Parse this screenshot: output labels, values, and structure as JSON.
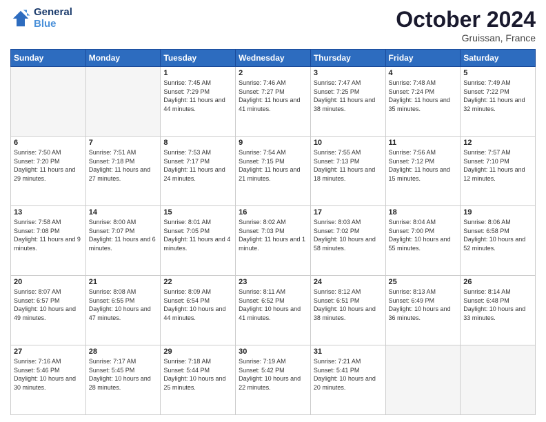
{
  "header": {
    "logo_line1": "General",
    "logo_line2": "Blue",
    "month": "October 2024",
    "location": "Gruissan, France"
  },
  "weekdays": [
    "Sunday",
    "Monday",
    "Tuesday",
    "Wednesday",
    "Thursday",
    "Friday",
    "Saturday"
  ],
  "weeks": [
    [
      {
        "day": "",
        "sunrise": "",
        "sunset": "",
        "daylight": "",
        "empty": true
      },
      {
        "day": "",
        "sunrise": "",
        "sunset": "",
        "daylight": "",
        "empty": true
      },
      {
        "day": "1",
        "sunrise": "Sunrise: 7:45 AM",
        "sunset": "Sunset: 7:29 PM",
        "daylight": "Daylight: 11 hours and 44 minutes."
      },
      {
        "day": "2",
        "sunrise": "Sunrise: 7:46 AM",
        "sunset": "Sunset: 7:27 PM",
        "daylight": "Daylight: 11 hours and 41 minutes."
      },
      {
        "day": "3",
        "sunrise": "Sunrise: 7:47 AM",
        "sunset": "Sunset: 7:25 PM",
        "daylight": "Daylight: 11 hours and 38 minutes."
      },
      {
        "day": "4",
        "sunrise": "Sunrise: 7:48 AM",
        "sunset": "Sunset: 7:24 PM",
        "daylight": "Daylight: 11 hours and 35 minutes."
      },
      {
        "day": "5",
        "sunrise": "Sunrise: 7:49 AM",
        "sunset": "Sunset: 7:22 PM",
        "daylight": "Daylight: 11 hours and 32 minutes."
      }
    ],
    [
      {
        "day": "6",
        "sunrise": "Sunrise: 7:50 AM",
        "sunset": "Sunset: 7:20 PM",
        "daylight": "Daylight: 11 hours and 29 minutes."
      },
      {
        "day": "7",
        "sunrise": "Sunrise: 7:51 AM",
        "sunset": "Sunset: 7:18 PM",
        "daylight": "Daylight: 11 hours and 27 minutes."
      },
      {
        "day": "8",
        "sunrise": "Sunrise: 7:53 AM",
        "sunset": "Sunset: 7:17 PM",
        "daylight": "Daylight: 11 hours and 24 minutes."
      },
      {
        "day": "9",
        "sunrise": "Sunrise: 7:54 AM",
        "sunset": "Sunset: 7:15 PM",
        "daylight": "Daylight: 11 hours and 21 minutes."
      },
      {
        "day": "10",
        "sunrise": "Sunrise: 7:55 AM",
        "sunset": "Sunset: 7:13 PM",
        "daylight": "Daylight: 11 hours and 18 minutes."
      },
      {
        "day": "11",
        "sunrise": "Sunrise: 7:56 AM",
        "sunset": "Sunset: 7:12 PM",
        "daylight": "Daylight: 11 hours and 15 minutes."
      },
      {
        "day": "12",
        "sunrise": "Sunrise: 7:57 AM",
        "sunset": "Sunset: 7:10 PM",
        "daylight": "Daylight: 11 hours and 12 minutes."
      }
    ],
    [
      {
        "day": "13",
        "sunrise": "Sunrise: 7:58 AM",
        "sunset": "Sunset: 7:08 PM",
        "daylight": "Daylight: 11 hours and 9 minutes."
      },
      {
        "day": "14",
        "sunrise": "Sunrise: 8:00 AM",
        "sunset": "Sunset: 7:07 PM",
        "daylight": "Daylight: 11 hours and 6 minutes."
      },
      {
        "day": "15",
        "sunrise": "Sunrise: 8:01 AM",
        "sunset": "Sunset: 7:05 PM",
        "daylight": "Daylight: 11 hours and 4 minutes."
      },
      {
        "day": "16",
        "sunrise": "Sunrise: 8:02 AM",
        "sunset": "Sunset: 7:03 PM",
        "daylight": "Daylight: 11 hours and 1 minute."
      },
      {
        "day": "17",
        "sunrise": "Sunrise: 8:03 AM",
        "sunset": "Sunset: 7:02 PM",
        "daylight": "Daylight: 10 hours and 58 minutes."
      },
      {
        "day": "18",
        "sunrise": "Sunrise: 8:04 AM",
        "sunset": "Sunset: 7:00 PM",
        "daylight": "Daylight: 10 hours and 55 minutes."
      },
      {
        "day": "19",
        "sunrise": "Sunrise: 8:06 AM",
        "sunset": "Sunset: 6:58 PM",
        "daylight": "Daylight: 10 hours and 52 minutes."
      }
    ],
    [
      {
        "day": "20",
        "sunrise": "Sunrise: 8:07 AM",
        "sunset": "Sunset: 6:57 PM",
        "daylight": "Daylight: 10 hours and 49 minutes."
      },
      {
        "day": "21",
        "sunrise": "Sunrise: 8:08 AM",
        "sunset": "Sunset: 6:55 PM",
        "daylight": "Daylight: 10 hours and 47 minutes."
      },
      {
        "day": "22",
        "sunrise": "Sunrise: 8:09 AM",
        "sunset": "Sunset: 6:54 PM",
        "daylight": "Daylight: 10 hours and 44 minutes."
      },
      {
        "day": "23",
        "sunrise": "Sunrise: 8:11 AM",
        "sunset": "Sunset: 6:52 PM",
        "daylight": "Daylight: 10 hours and 41 minutes."
      },
      {
        "day": "24",
        "sunrise": "Sunrise: 8:12 AM",
        "sunset": "Sunset: 6:51 PM",
        "daylight": "Daylight: 10 hours and 38 minutes."
      },
      {
        "day": "25",
        "sunrise": "Sunrise: 8:13 AM",
        "sunset": "Sunset: 6:49 PM",
        "daylight": "Daylight: 10 hours and 36 minutes."
      },
      {
        "day": "26",
        "sunrise": "Sunrise: 8:14 AM",
        "sunset": "Sunset: 6:48 PM",
        "daylight": "Daylight: 10 hours and 33 minutes."
      }
    ],
    [
      {
        "day": "27",
        "sunrise": "Sunrise: 7:16 AM",
        "sunset": "Sunset: 5:46 PM",
        "daylight": "Daylight: 10 hours and 30 minutes."
      },
      {
        "day": "28",
        "sunrise": "Sunrise: 7:17 AM",
        "sunset": "Sunset: 5:45 PM",
        "daylight": "Daylight: 10 hours and 28 minutes."
      },
      {
        "day": "29",
        "sunrise": "Sunrise: 7:18 AM",
        "sunset": "Sunset: 5:44 PM",
        "daylight": "Daylight: 10 hours and 25 minutes."
      },
      {
        "day": "30",
        "sunrise": "Sunrise: 7:19 AM",
        "sunset": "Sunset: 5:42 PM",
        "daylight": "Daylight: 10 hours and 22 minutes."
      },
      {
        "day": "31",
        "sunrise": "Sunrise: 7:21 AM",
        "sunset": "Sunset: 5:41 PM",
        "daylight": "Daylight: 10 hours and 20 minutes."
      },
      {
        "day": "",
        "sunrise": "",
        "sunset": "",
        "daylight": "",
        "empty": true
      },
      {
        "day": "",
        "sunrise": "",
        "sunset": "",
        "daylight": "",
        "empty": true
      }
    ]
  ]
}
